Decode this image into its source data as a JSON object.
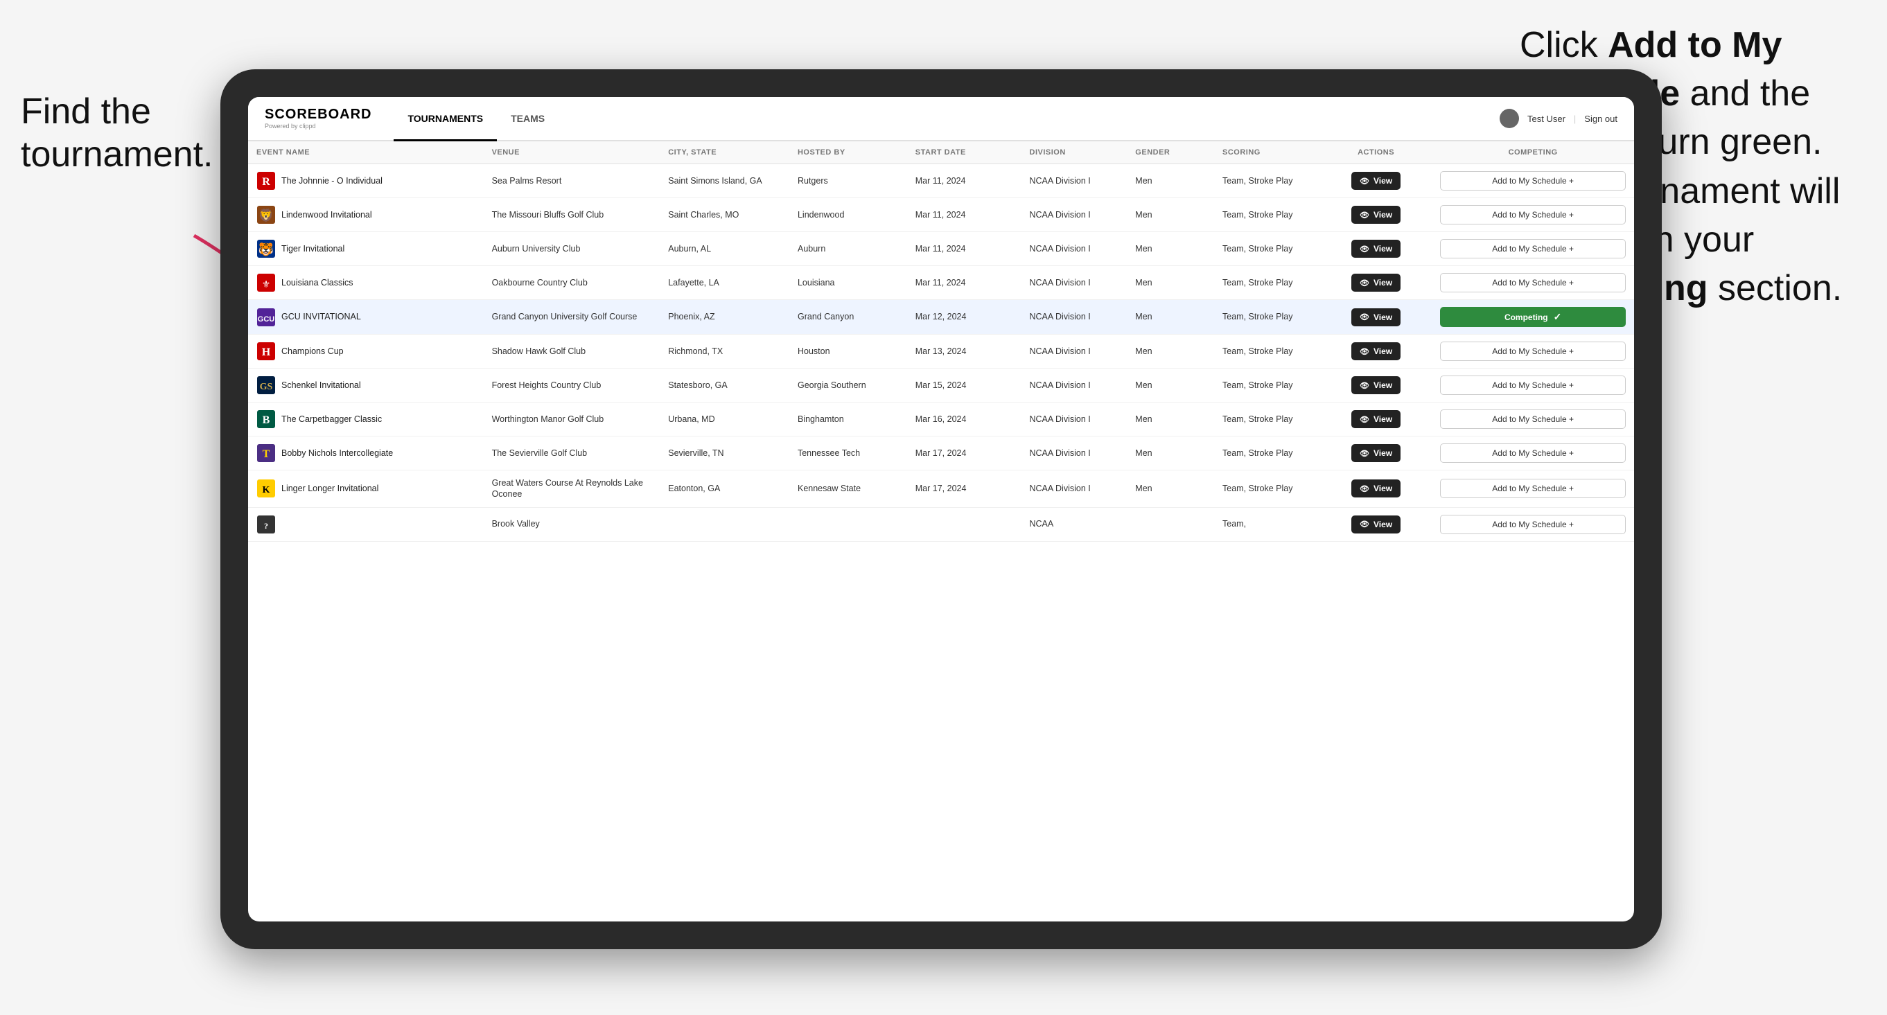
{
  "annotations": {
    "left": "Find the\ntournament.",
    "right_line1": "Click ",
    "right_bold1": "Add to My\nSchedule",
    "right_line2": " and the\nbox will turn green.\nThis tournament\nwill now be in\nyour ",
    "right_bold2": "Competing",
    "right_line3": "\nsection."
  },
  "nav": {
    "logo": "SCOREBOARD",
    "logo_sub": "Powered by clippd",
    "tabs": [
      "TOURNAMENTS",
      "TEAMS"
    ],
    "active_tab": "TOURNAMENTS",
    "user_label": "Test User",
    "sign_out": "Sign out"
  },
  "table": {
    "columns": [
      "EVENT NAME",
      "VENUE",
      "CITY, STATE",
      "HOSTED BY",
      "START DATE",
      "DIVISION",
      "GENDER",
      "SCORING",
      "ACTIONS",
      "COMPETING"
    ],
    "rows": [
      {
        "logo": "🔴",
        "event": "The Johnnie - O Individual",
        "venue": "Sea Palms Resort",
        "city": "Saint Simons Island, GA",
        "hosted": "Rutgers",
        "date": "Mar 11, 2024",
        "division": "NCAA Division I",
        "gender": "Men",
        "scoring": "Team, Stroke Play",
        "action": "View",
        "competing_type": "add",
        "competing_label": "Add to My Schedule +"
      },
      {
        "logo": "🦁",
        "event": "Lindenwood Invitational",
        "venue": "The Missouri Bluffs Golf Club",
        "city": "Saint Charles, MO",
        "hosted": "Lindenwood",
        "date": "Mar 11, 2024",
        "division": "NCAA Division I",
        "gender": "Men",
        "scoring": "Team, Stroke Play",
        "action": "View",
        "competing_type": "add",
        "competing_label": "Add to My Schedule +"
      },
      {
        "logo": "🐯",
        "event": "Tiger Invitational",
        "venue": "Auburn University Club",
        "city": "Auburn, AL",
        "hosted": "Auburn",
        "date": "Mar 11, 2024",
        "division": "NCAA Division I",
        "gender": "Men",
        "scoring": "Team, Stroke Play",
        "action": "View",
        "competing_type": "add",
        "competing_label": "Add to My Schedule +"
      },
      {
        "logo": "⚜️",
        "event": "Louisiana Classics",
        "venue": "Oakbourne Country Club",
        "city": "Lafayette, LA",
        "hosted": "Louisiana",
        "date": "Mar 11, 2024",
        "division": "NCAA Division I",
        "gender": "Men",
        "scoring": "Team, Stroke Play",
        "action": "View",
        "competing_type": "add",
        "competing_label": "Add to My Schedule +"
      },
      {
        "logo": "🏔️",
        "event": "GCU INVITATIONAL",
        "venue": "Grand Canyon University Golf Course",
        "city": "Phoenix, AZ",
        "hosted": "Grand Canyon",
        "date": "Mar 12, 2024",
        "division": "NCAA Division I",
        "gender": "Men",
        "scoring": "Team, Stroke Play",
        "action": "View",
        "competing_type": "competing",
        "competing_label": "Competing ✓",
        "highlighted": true
      },
      {
        "logo": "⚡",
        "event": "Champions Cup",
        "venue": "Shadow Hawk Golf Club",
        "city": "Richmond, TX",
        "hosted": "Houston",
        "date": "Mar 13, 2024",
        "division": "NCAA Division I",
        "gender": "Men",
        "scoring": "Team, Stroke Play",
        "action": "View",
        "competing_type": "add",
        "competing_label": "Add to My Schedule +"
      },
      {
        "logo": "🦅",
        "event": "Schenkel Invitational",
        "venue": "Forest Heights Country Club",
        "city": "Statesboro, GA",
        "hosted": "Georgia Southern",
        "date": "Mar 15, 2024",
        "division": "NCAA Division I",
        "gender": "Men",
        "scoring": "Team, Stroke Play",
        "action": "View",
        "competing_type": "add",
        "competing_label": "Add to My Schedule +"
      },
      {
        "logo": "🔵",
        "event": "The Carpetbagger Classic",
        "venue": "Worthington Manor Golf Club",
        "city": "Urbana, MD",
        "hosted": "Binghamton",
        "date": "Mar 16, 2024",
        "division": "NCAA Division I",
        "gender": "Men",
        "scoring": "Team, Stroke Play",
        "action": "View",
        "competing_type": "add",
        "competing_label": "Add to My Schedule +"
      },
      {
        "logo": "🟡",
        "event": "Bobby Nichols Intercollegiate",
        "venue": "The Sevierville Golf Club",
        "city": "Sevierville, TN",
        "hosted": "Tennessee Tech",
        "date": "Mar 17, 2024",
        "division": "NCAA Division I",
        "gender": "Men",
        "scoring": "Team, Stroke Play",
        "action": "View",
        "competing_type": "add",
        "competing_label": "Add to My Schedule +"
      },
      {
        "logo": "🟤",
        "event": "Linger Longer Invitational",
        "venue": "Great Waters Course At Reynolds Lake Oconee",
        "city": "Eatonton, GA",
        "hosted": "Kennesaw State",
        "date": "Mar 17, 2024",
        "division": "NCAA Division I",
        "gender": "Men",
        "scoring": "Team, Stroke Play",
        "action": "View",
        "competing_type": "add",
        "competing_label": "Add to My Schedule +"
      },
      {
        "logo": "⬛",
        "event": "",
        "venue": "Brook Valley",
        "city": "",
        "hosted": "",
        "date": "",
        "division": "NCAA",
        "gender": "",
        "scoring": "Team,",
        "action": "View",
        "competing_type": "add",
        "competing_label": "Add to My Schedule +"
      }
    ]
  }
}
